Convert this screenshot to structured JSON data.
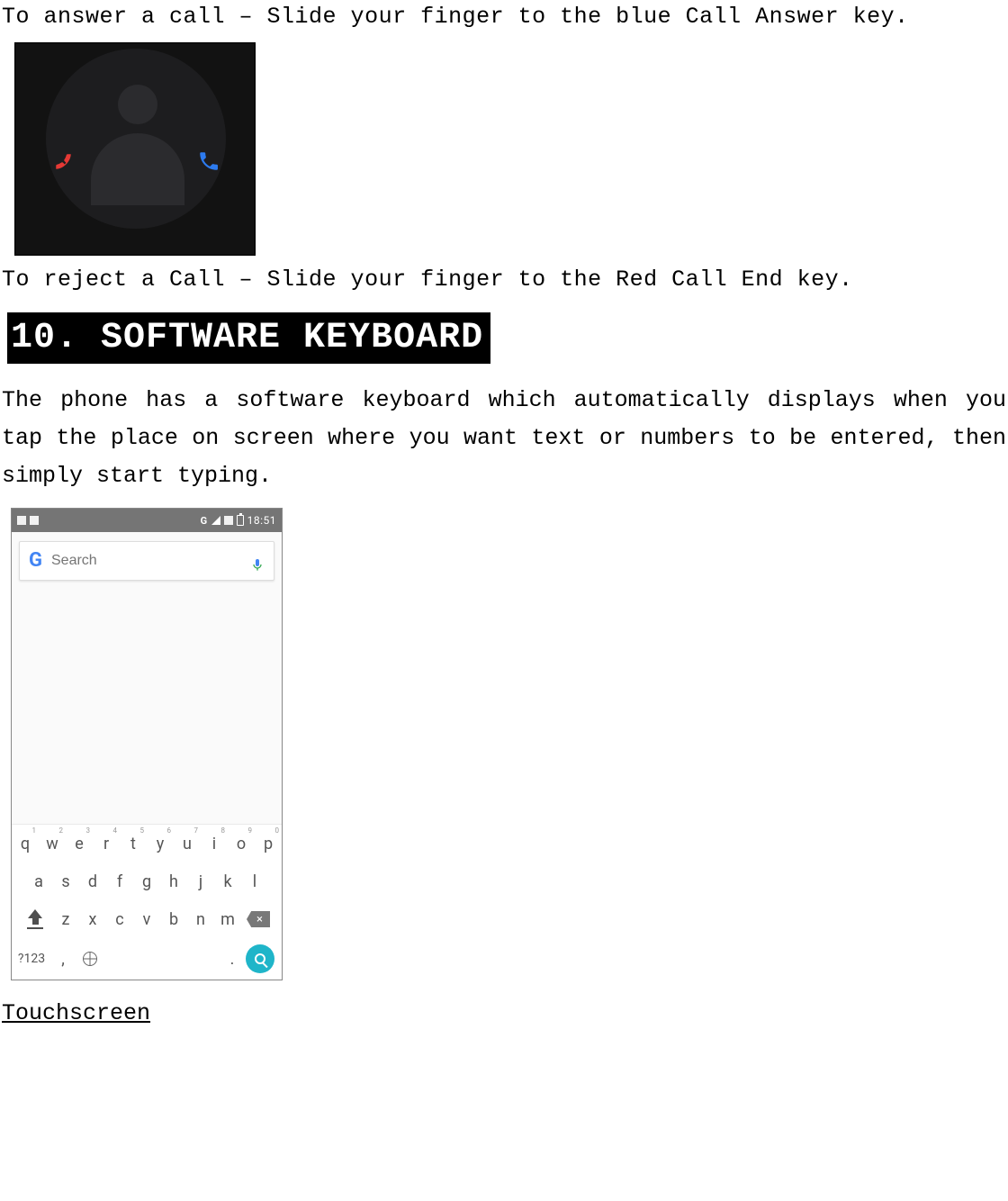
{
  "instructions": {
    "answer": "To answer a call – Slide your finger to the blue Call Answer key.",
    "reject": "To reject a Call – Slide your finger to the Red Call End key."
  },
  "section": {
    "number": "10.",
    "title": "SOFTWARE KEYBOARD",
    "heading_full": "10. SOFTWARE KEYBOARD"
  },
  "paragraph": "The phone has a software keyboard which automatically displays when you tap the place on screen where you want text or numbers to be entered, then simply start typing.",
  "phone": {
    "statusbar": {
      "net": "G",
      "time": "18:51"
    },
    "search": {
      "placeholder": "Search"
    },
    "keyboard": {
      "row1": [
        {
          "k": "q",
          "h": "1"
        },
        {
          "k": "w",
          "h": "2"
        },
        {
          "k": "e",
          "h": "3"
        },
        {
          "k": "r",
          "h": "4"
        },
        {
          "k": "t",
          "h": "5"
        },
        {
          "k": "y",
          "h": "6"
        },
        {
          "k": "u",
          "h": "7"
        },
        {
          "k": "i",
          "h": "8"
        },
        {
          "k": "o",
          "h": "9"
        },
        {
          "k": "p",
          "h": "0"
        }
      ],
      "row2": [
        "a",
        "s",
        "d",
        "f",
        "g",
        "h",
        "j",
        "k",
        "l"
      ],
      "row3": [
        "z",
        "x",
        "c",
        "v",
        "b",
        "n",
        "m"
      ],
      "sym": "?123",
      "comma": ",",
      "dot": "."
    }
  },
  "subheading": "Touchscreen"
}
